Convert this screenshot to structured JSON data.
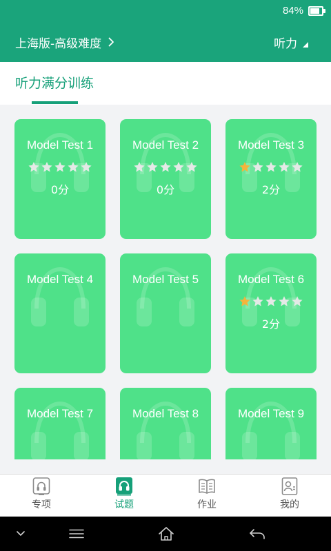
{
  "status_bar": {
    "battery_text": "84%",
    "battery_level": 0.84
  },
  "header": {
    "edition": "上海版-高级难度",
    "subject": "听力"
  },
  "tab": {
    "label": "听力满分训练",
    "active": true
  },
  "tests": [
    {
      "title": "Model Test 1",
      "rating": {
        "filled": 0,
        "total": 5
      },
      "score": "0分"
    },
    {
      "title": "Model Test 2",
      "rating": {
        "filled": 0,
        "total": 5
      },
      "score": "0分"
    },
    {
      "title": "Model Test 3",
      "rating": {
        "filled": 1,
        "total": 5
      },
      "score": "2分"
    },
    {
      "title": "Model Test 4"
    },
    {
      "title": "Model Test 5"
    },
    {
      "title": "Model Test 6",
      "rating": {
        "filled": 1,
        "total": 5
      },
      "score": "2分"
    },
    {
      "title": "Model Test 7"
    },
    {
      "title": "Model Test 8"
    },
    {
      "title": "Model Test 9"
    }
  ],
  "bottom_nav": {
    "items": [
      {
        "label": "专项",
        "icon": "special-practice-icon",
        "active": false
      },
      {
        "label": "试题",
        "icon": "exam-headphone-icon",
        "active": true
      },
      {
        "label": "作业",
        "icon": "homework-book-icon",
        "active": false
      },
      {
        "label": "我的",
        "icon": "profile-card-icon",
        "active": false
      }
    ]
  },
  "system_nav": {
    "icons": [
      "chevron-down-icon",
      "menu-icon",
      "home-icon",
      "back-icon"
    ]
  },
  "colors": {
    "primary": "#1aa47b",
    "card": "#4fe189",
    "star_filled": "#f4b43c",
    "star_empty": "#e4e9e6",
    "background": "#f2f3f5",
    "nav_active": "#16a079",
    "nav_inactive": "#555555"
  }
}
